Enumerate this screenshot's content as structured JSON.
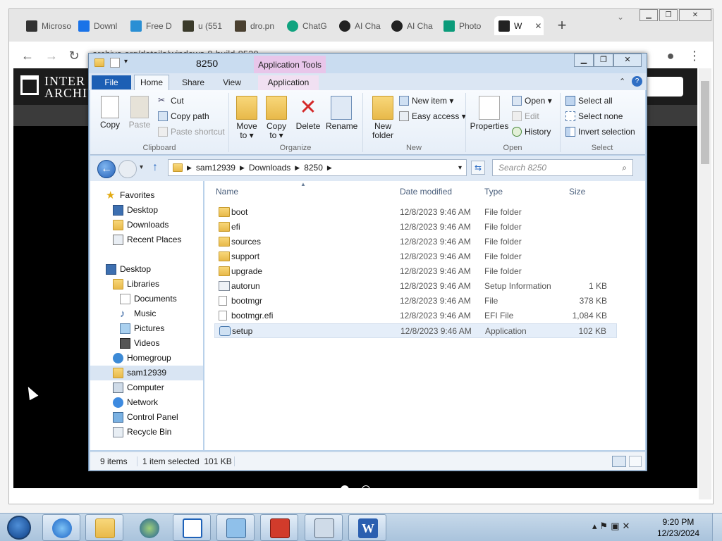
{
  "browser": {
    "tabs": [
      {
        "label": "Microso",
        "icon": "microsoft-icon"
      },
      {
        "label": "Downl",
        "icon": "download-icon"
      },
      {
        "label": "Free D",
        "icon": "free-d-icon"
      },
      {
        "label": "u (551",
        "icon": "u-icon"
      },
      {
        "label": "dro.pn",
        "icon": "image-icon"
      },
      {
        "label": "ChatG",
        "icon": "chatgpt-icon"
      },
      {
        "label": "AI Cha",
        "icon": "ai-chat-icon"
      },
      {
        "label": "AI Cha",
        "icon": "ai-chat-icon"
      },
      {
        "label": "Photo",
        "icon": "photo-icon"
      },
      {
        "label": "W",
        "icon": "archive-icon",
        "active": true
      }
    ],
    "url": "archive.org/details/windows-8-build-8520",
    "colors": {
      "tabstrip": "#e6e6e6",
      "page_bg": "#000000"
    }
  },
  "archive": {
    "logo_line1": "INTER",
    "logo_line2": "ARCHIV"
  },
  "explorer": {
    "title": "8250",
    "app_tools": "Application Tools",
    "tabs": {
      "file": "File",
      "home": "Home",
      "share": "Share",
      "view": "View",
      "application": "Application"
    },
    "ribbon": {
      "copy": "Copy",
      "paste": "Paste",
      "cut": "Cut",
      "copy_path": "Copy path",
      "paste_shortcut": "Paste shortcut",
      "clipboard": "Clipboard",
      "move_to": "Move to ▾",
      "copy_to": "Copy to ▾",
      "delete": "Delete",
      "rename": "Rename",
      "organize": "Organize",
      "new_folder": "New folder",
      "new_item": "New item ▾",
      "easy_access": "Easy access ▾",
      "new": "New",
      "properties": "Properties",
      "open": "Open ▾",
      "edit": "Edit",
      "history": "History",
      "open_group": "Open",
      "select_all": "Select all",
      "select_none": "Select none",
      "invert_selection": "Invert selection",
      "select": "Select"
    },
    "breadcrumb": [
      "sam12939",
      "Downloads",
      "8250"
    ],
    "search_placeholder": "Search 8250",
    "nav": [
      {
        "label": "Favorites",
        "name": "nav-favorites"
      },
      {
        "label": "Desktop",
        "name": "nav-fav-desktop"
      },
      {
        "label": "Downloads",
        "name": "nav-downloads"
      },
      {
        "label": "Recent Places",
        "name": "nav-recent-places"
      },
      {
        "label": "Desktop",
        "name": "nav-desktop"
      },
      {
        "label": "Libraries",
        "name": "nav-libraries"
      },
      {
        "label": "Documents",
        "name": "nav-documents"
      },
      {
        "label": "Music",
        "name": "nav-music"
      },
      {
        "label": "Pictures",
        "name": "nav-pictures"
      },
      {
        "label": "Videos",
        "name": "nav-videos"
      },
      {
        "label": "Homegroup",
        "name": "nav-homegroup"
      },
      {
        "label": "sam12939",
        "name": "nav-user"
      },
      {
        "label": "Computer",
        "name": "nav-computer"
      },
      {
        "label": "Network",
        "name": "nav-network"
      },
      {
        "label": "Control Panel",
        "name": "nav-control-panel"
      },
      {
        "label": "Recycle Bin",
        "name": "nav-recycle-bin"
      }
    ],
    "columns": {
      "name": "Name",
      "date": "Date modified",
      "type": "Type",
      "size": "Size"
    },
    "files": [
      {
        "name": "boot",
        "date": "12/8/2023 9:46 AM",
        "type": "File folder",
        "size": "",
        "kind": "folder"
      },
      {
        "name": "efi",
        "date": "12/8/2023 9:46 AM",
        "type": "File folder",
        "size": "",
        "kind": "folder"
      },
      {
        "name": "sources",
        "date": "12/8/2023 9:46 AM",
        "type": "File folder",
        "size": "",
        "kind": "folder"
      },
      {
        "name": "support",
        "date": "12/8/2023 9:46 AM",
        "type": "File folder",
        "size": "",
        "kind": "folder"
      },
      {
        "name": "upgrade",
        "date": "12/8/2023 9:46 AM",
        "type": "File folder",
        "size": "",
        "kind": "folder"
      },
      {
        "name": "autorun",
        "date": "12/8/2023 9:46 AM",
        "type": "Setup Information",
        "size": "1 KB",
        "kind": "inf"
      },
      {
        "name": "bootmgr",
        "date": "12/8/2023 9:46 AM",
        "type": "File",
        "size": "378 KB",
        "kind": "file"
      },
      {
        "name": "bootmgr.efi",
        "date": "12/8/2023 9:46 AM",
        "type": "EFI File",
        "size": "1,084 KB",
        "kind": "file"
      },
      {
        "name": "setup",
        "date": "12/8/2023 9:46 AM",
        "type": "Application",
        "size": "102 KB",
        "kind": "app",
        "selected": true
      }
    ],
    "status_items": "9 items",
    "status_selected": "1 item selected  101 KB"
  },
  "taskbar": {
    "time": "9:20 PM",
    "date": "12/23/2024",
    "apps": [
      "internet-explorer-icon",
      "file-explorer-icon",
      "media-player-icon",
      "app-transfer-icon",
      "control-panel-icon",
      "toolbox-icon",
      "network-computer-icon",
      "word-icon"
    ]
  }
}
